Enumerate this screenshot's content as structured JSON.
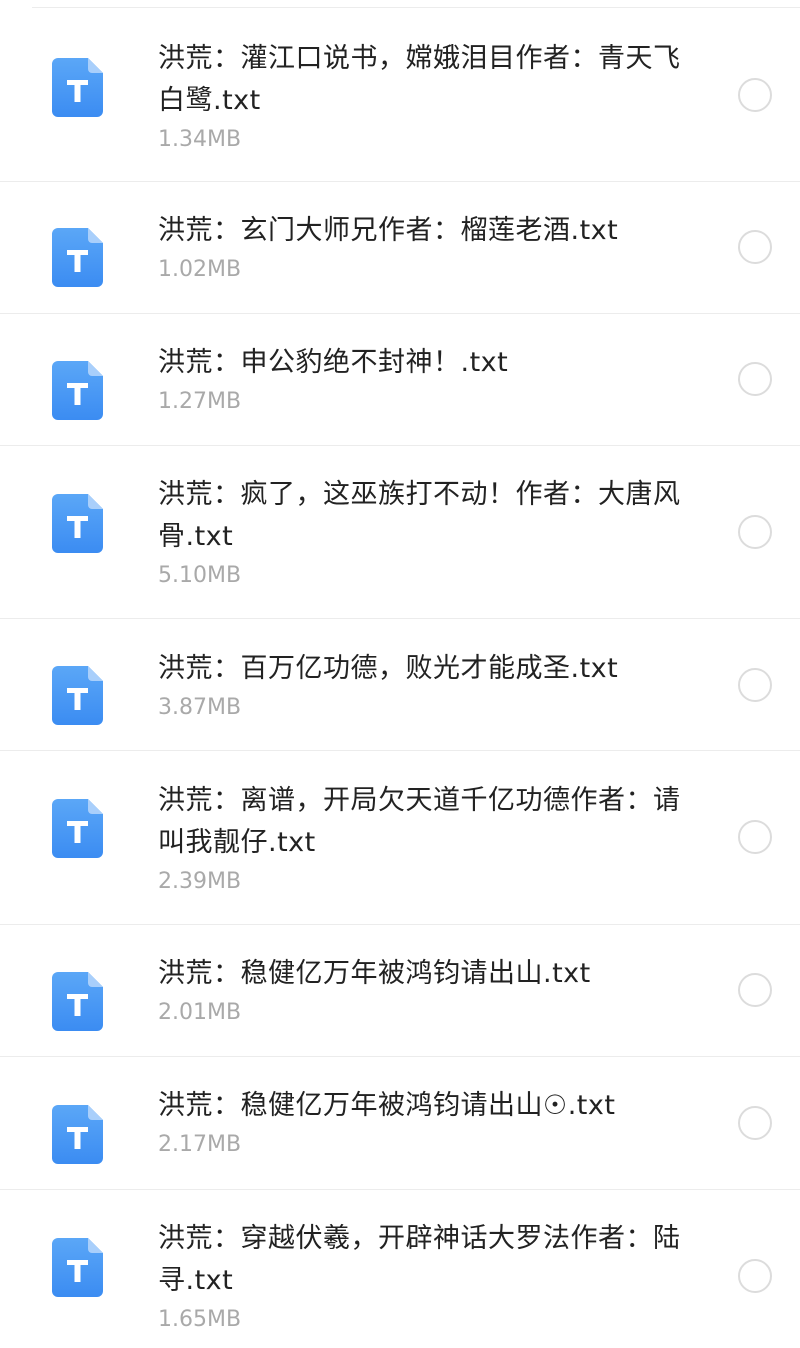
{
  "files": [
    {
      "name": "洪荒：灌江口说书，嫦娥泪目作者：青天飞白鹭.txt",
      "size": "1.34MB",
      "icon": "txt-file-icon",
      "selected": false
    },
    {
      "name": "洪荒：玄门大师兄作者：榴莲老酒.txt",
      "size": "1.02MB",
      "icon": "txt-file-icon",
      "selected": false
    },
    {
      "name": "洪荒：申公豹绝不封神！.txt",
      "size": "1.27MB",
      "icon": "txt-file-icon",
      "selected": false
    },
    {
      "name": "洪荒：疯了，这巫族打不动！作者：大唐风骨.txt",
      "size": "5.10MB",
      "icon": "txt-file-icon",
      "selected": false
    },
    {
      "name": "洪荒：百万亿功德，败光才能成圣.txt",
      "size": "3.87MB",
      "icon": "txt-file-icon",
      "selected": false
    },
    {
      "name": "洪荒：离谱，开局欠天道千亿功德作者：请叫我靓仔.txt",
      "size": "2.39MB",
      "icon": "txt-file-icon",
      "selected": false
    },
    {
      "name": "洪荒：稳健亿万年被鸿钧请出山.txt",
      "size": "2.01MB",
      "icon": "txt-file-icon",
      "selected": false
    },
    {
      "name": "洪荒：稳健亿万年被鸿钧请出山☉.txt",
      "size": "2.17MB",
      "icon": "txt-file-icon",
      "selected": false
    },
    {
      "name": "洪荒：穿越伏羲，开辟神话大罗法作者：陆寻.txt",
      "size": "1.65MB",
      "icon": "txt-file-icon",
      "selected": false
    }
  ],
  "colors": {
    "icon_blue_top": "#5ba7f7",
    "icon_blue_bottom": "#3b8cf2",
    "icon_fold": "#a9cffb",
    "name_text": "#222222",
    "size_text": "#a9a9a9",
    "divider": "#ececec",
    "radio_border": "#dcdcdc"
  }
}
